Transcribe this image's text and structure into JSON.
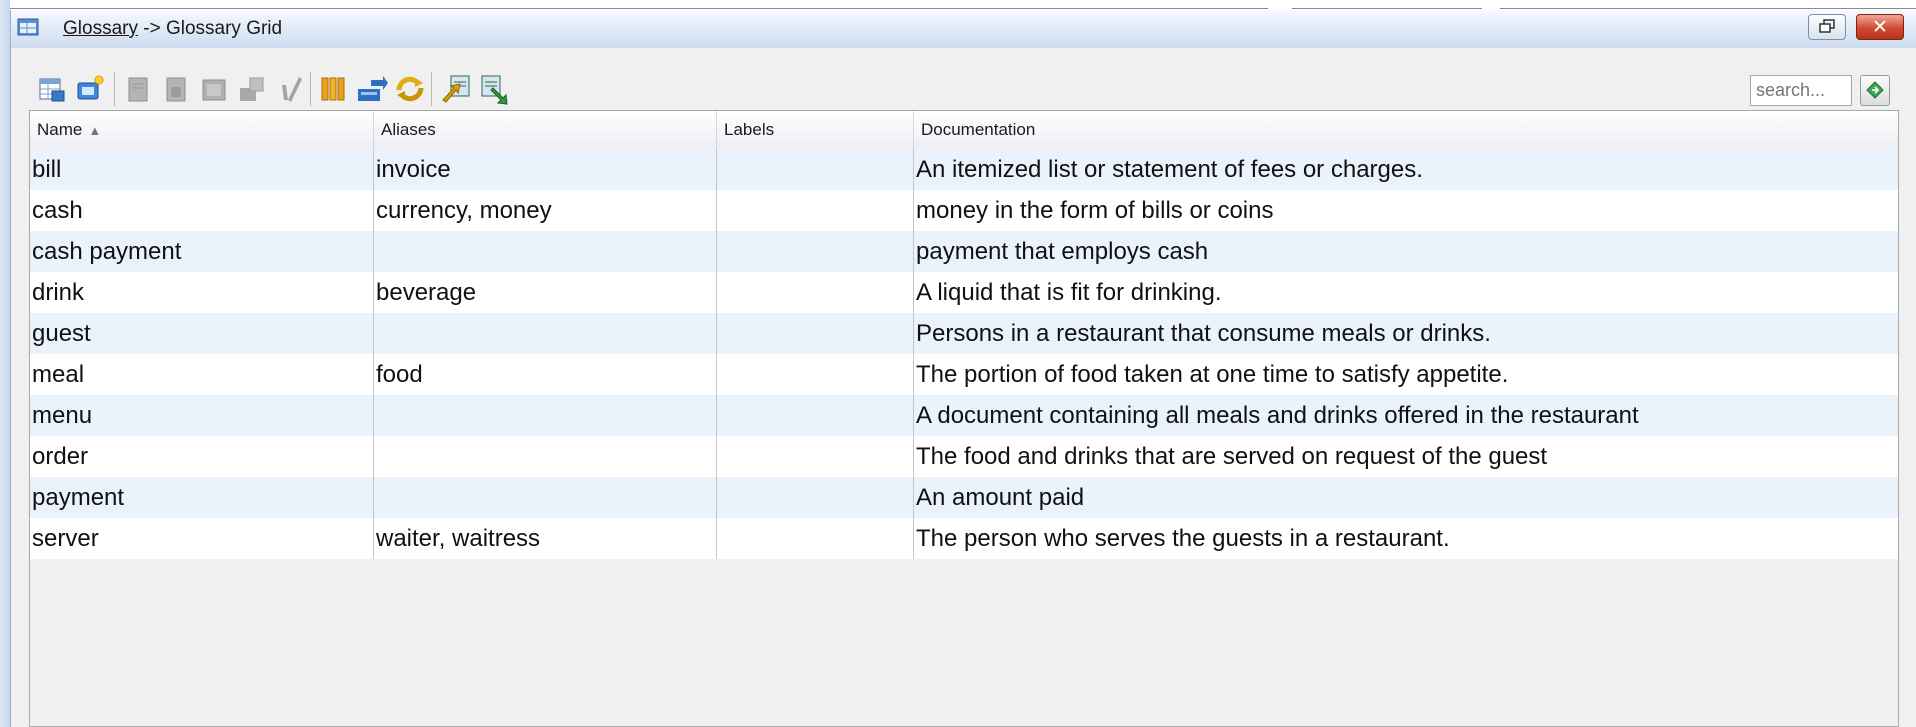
{
  "window": {
    "title_link": "Glossary",
    "title_rest": " -> Glossary Grid"
  },
  "toolbar": {
    "buttons": [
      "add-element-icon",
      "add-relationship-icon",
      "open-page-icon",
      "properties-icon",
      "reference-icon",
      "pin-icon",
      "check-icon",
      "columns-icon",
      "move-icon",
      "refresh-icon",
      "import-icon",
      "export-icon"
    ]
  },
  "search": {
    "placeholder": "search..."
  },
  "grid": {
    "columns": [
      "Name",
      "Aliases",
      "Labels",
      "Documentation"
    ],
    "sort_indicator": "▲",
    "rows": [
      {
        "name": "bill",
        "aliases": "invoice",
        "labels": "",
        "documentation": "An itemized list or statement of fees or charges."
      },
      {
        "name": "cash",
        "aliases": "currency, money",
        "labels": "",
        "documentation": "money in the form of bills or coins"
      },
      {
        "name": "cash payment",
        "aliases": "",
        "labels": "",
        "documentation": "payment that employs cash"
      },
      {
        "name": "drink",
        "aliases": "beverage",
        "labels": "",
        "documentation": "A liquid that is fit for drinking."
      },
      {
        "name": "guest",
        "aliases": "",
        "labels": "",
        "documentation": "Persons in a restaurant that consume meals or drinks."
      },
      {
        "name": "meal",
        "aliases": "food",
        "labels": "",
        "documentation": "The portion of food taken at one time to satisfy appetite."
      },
      {
        "name": "menu",
        "aliases": "",
        "labels": "",
        "documentation": "A document containing all meals and drinks offered in the restaurant"
      },
      {
        "name": "order",
        "aliases": "",
        "labels": "",
        "documentation": "The food and drinks that are served on request of the guest"
      },
      {
        "name": "payment",
        "aliases": "",
        "labels": "",
        "documentation": "An amount paid"
      },
      {
        "name": "server",
        "aliases": "waiter, waitress",
        "labels": "",
        "documentation": "The person who serves the guests in a restaurant."
      }
    ]
  },
  "colors": {
    "row_even": "#ffffff",
    "row_odd": "#eaf2fb",
    "titlebar": "#dfe9f6",
    "close_button": "#cf4a32"
  }
}
